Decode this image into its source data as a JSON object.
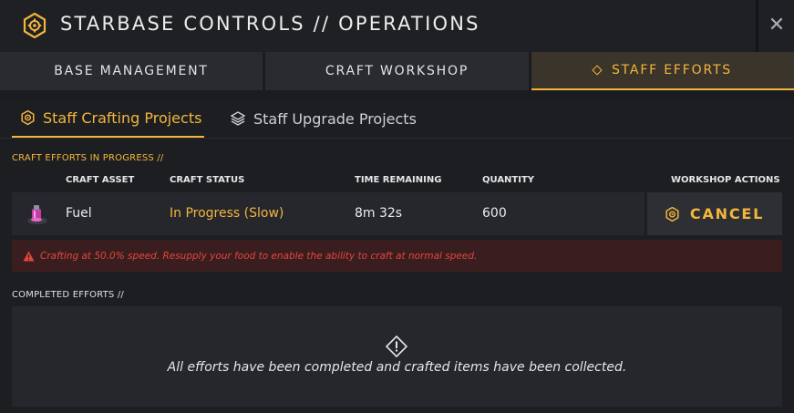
{
  "window": {
    "title": "STARBASE CONTROLS // OPERATIONS",
    "title_icon": "starbase-gear-icon",
    "close_icon": "close-icon",
    "close_glyph": "✕"
  },
  "tabs": [
    {
      "label": "BASE MANAGEMENT",
      "active": false
    },
    {
      "label": "CRAFT WORKSHOP",
      "active": false
    },
    {
      "label": "STAFF EFFORTS",
      "active": true,
      "icon": "diamond-icon"
    }
  ],
  "subtabs": [
    {
      "label": "Staff Crafting Projects",
      "active": true,
      "icon": "gear-icon"
    },
    {
      "label": "Staff Upgrade Projects",
      "active": false,
      "icon": "layers-icon"
    }
  ],
  "in_progress": {
    "section_label": "CRAFT EFFORTS IN PROGRESS //",
    "columns": {
      "asset": "CRAFT ASSET",
      "status": "CRAFT STATUS",
      "time": "TIME REMAINING",
      "quantity": "QUANTITY",
      "actions": "WORKSHOP ACTIONS"
    },
    "rows": [
      {
        "asset": "Fuel",
        "asset_icon": "fuel-icon",
        "status": "In Progress (Slow)",
        "time_remaining": "8m 32s",
        "quantity": "600",
        "action_label": "CANCEL",
        "action_icon": "gear-icon"
      }
    ]
  },
  "warning": {
    "icon": "warning-triangle-icon",
    "text": "Crafting at 50.0% speed. Resupply your food to enable the ability to craft at normal speed."
  },
  "completed": {
    "section_label": "COMPLETED EFFORTS //",
    "empty_icon": "alert-diamond-icon",
    "empty_text": "All efforts have been completed and crafted items have been collected."
  },
  "colors": {
    "accent": "#f3b63c",
    "background": "#1b1c20",
    "warning_text": "#e2453c",
    "warning_bg": "#3a1e1f"
  }
}
